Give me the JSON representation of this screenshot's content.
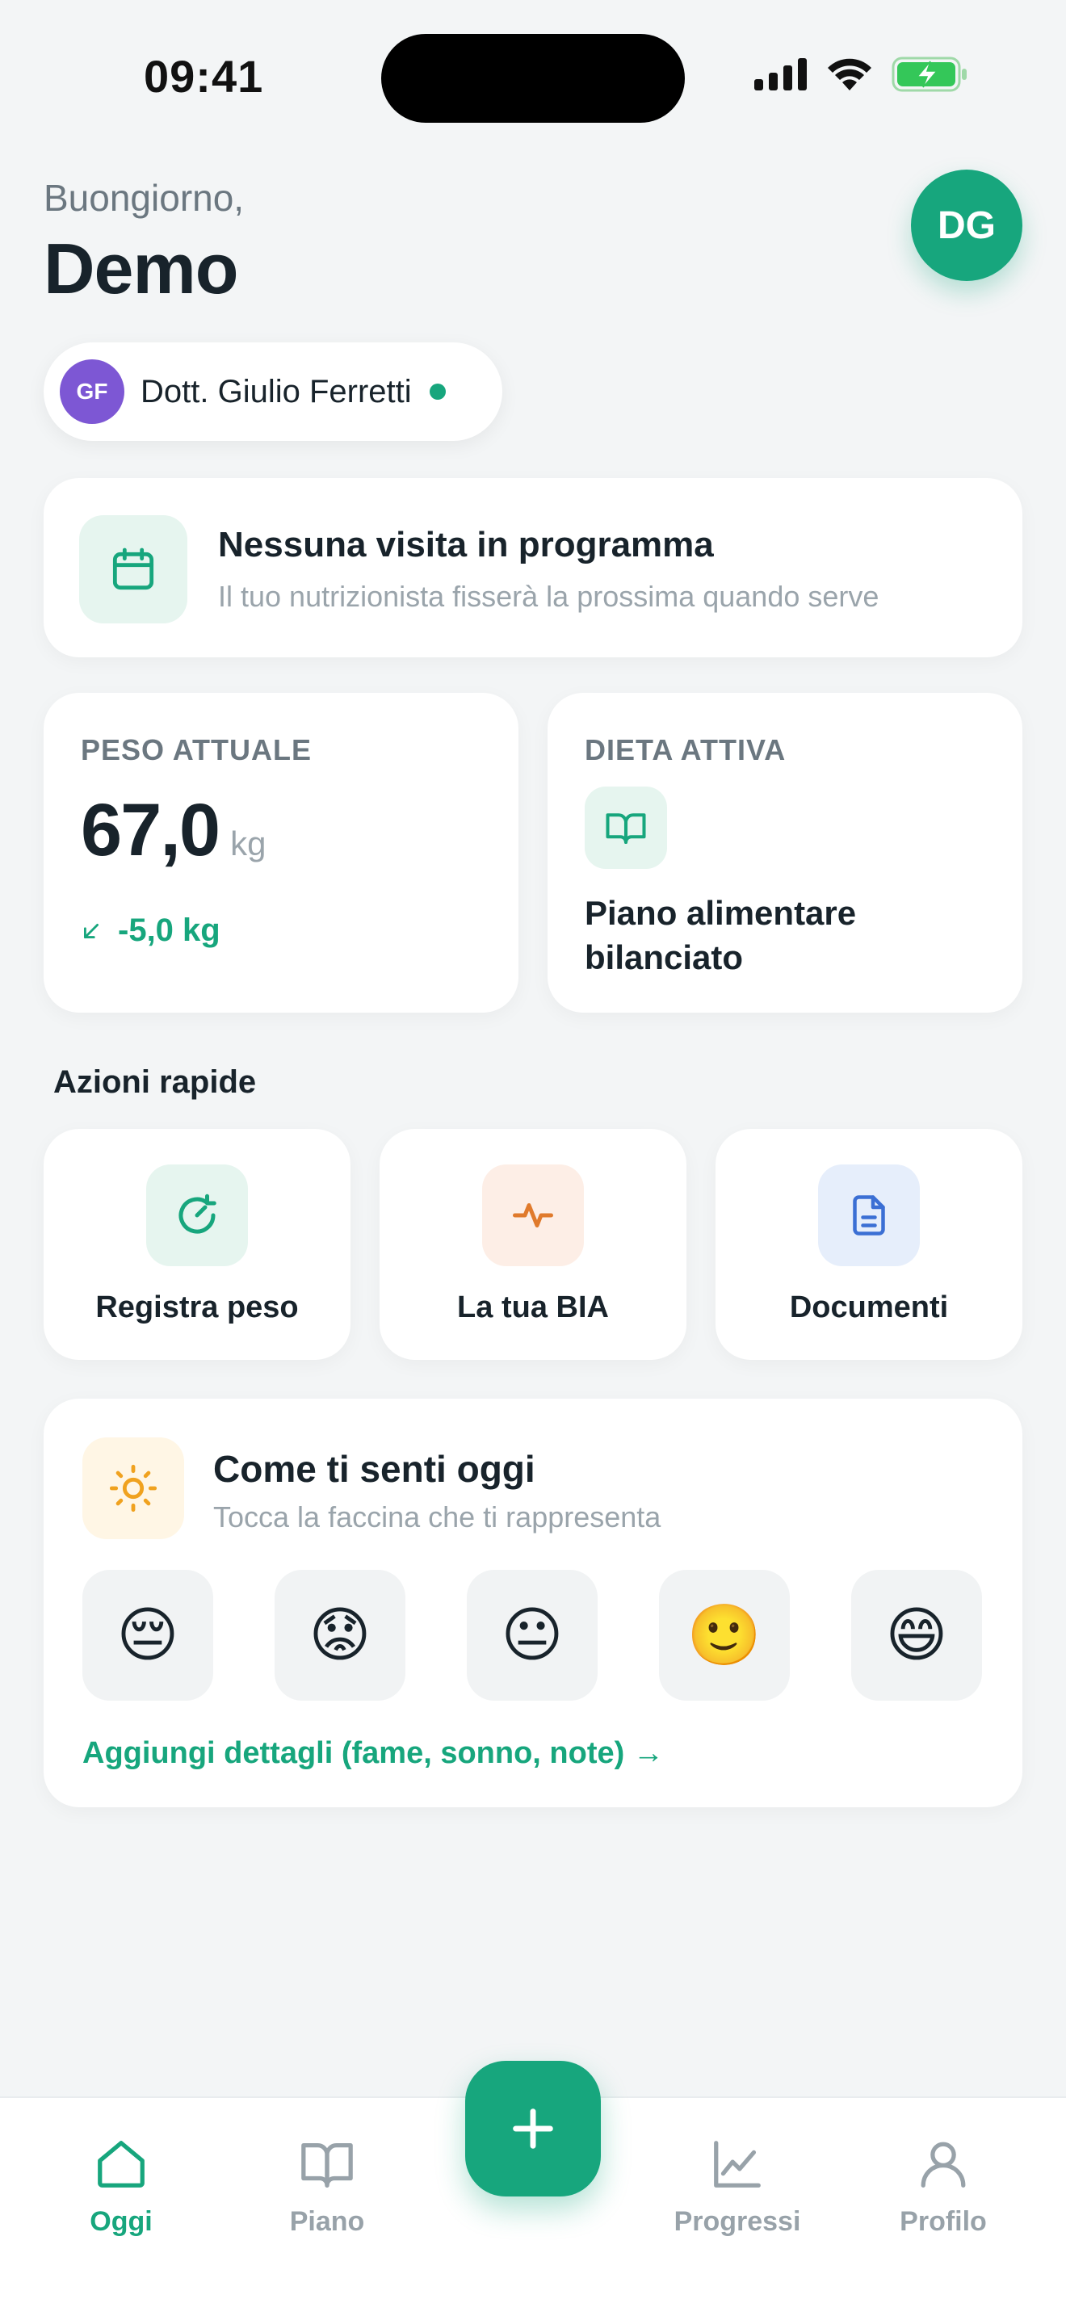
{
  "status_bar": {
    "time": "09:41",
    "icons": [
      "signal-icon",
      "wifi-icon",
      "battery-charging-icon"
    ]
  },
  "header": {
    "greeting": "Buongiorno,",
    "name": "Demo",
    "avatar_initials": "DG",
    "doctor": {
      "initials": "GF",
      "name": "Dott. Giulio Ferretti",
      "status": "online"
    }
  },
  "visit": {
    "title": "Nessuna visita in programma",
    "subtitle": "Il tuo nutrizionista fisserà la prossima quando serve",
    "icon": "calendar-icon"
  },
  "weight": {
    "label": "PESO ATTUALE",
    "value": "67,0",
    "unit": "kg",
    "delta": "-5,0 kg",
    "delta_icon": "arrow-down-left-icon"
  },
  "diet": {
    "label": "DIETA ATTIVA",
    "title": "Piano alimentare bilanciato",
    "icon": "book-open-icon"
  },
  "quick_actions": {
    "title": "Azioni rapide",
    "items": [
      {
        "label": "Registra peso",
        "icon": "refresh-scale-icon",
        "color": "#e6f5ef"
      },
      {
        "label": "La tua BIA",
        "icon": "activity-icon",
        "color": "#fdeee6"
      },
      {
        "label": "Documenti",
        "icon": "document-icon",
        "color": "#e6eefb"
      }
    ]
  },
  "mood": {
    "title": "Come ti senti oggi",
    "subtitle": "Tocca la faccina che ti rappresenta",
    "icon": "sun-icon",
    "faces": [
      "😔",
      "😟",
      "😐",
      "🙂",
      "😄"
    ],
    "link": "Aggiungi dettagli (fame, sonno, note) →"
  },
  "nav": {
    "items": [
      {
        "label": "Oggi",
        "icon": "home-icon",
        "active": true
      },
      {
        "label": "Piano",
        "icon": "book-icon"
      },
      {
        "label": "Progressi",
        "icon": "chart-icon"
      },
      {
        "label": "Profilo",
        "icon": "user-icon"
      }
    ],
    "fab_icon": "plus-icon"
  },
  "colors": {
    "accent": "#17a67d",
    "background": "#f3f5f6",
    "doctor_avatar": "#7d57d4"
  }
}
